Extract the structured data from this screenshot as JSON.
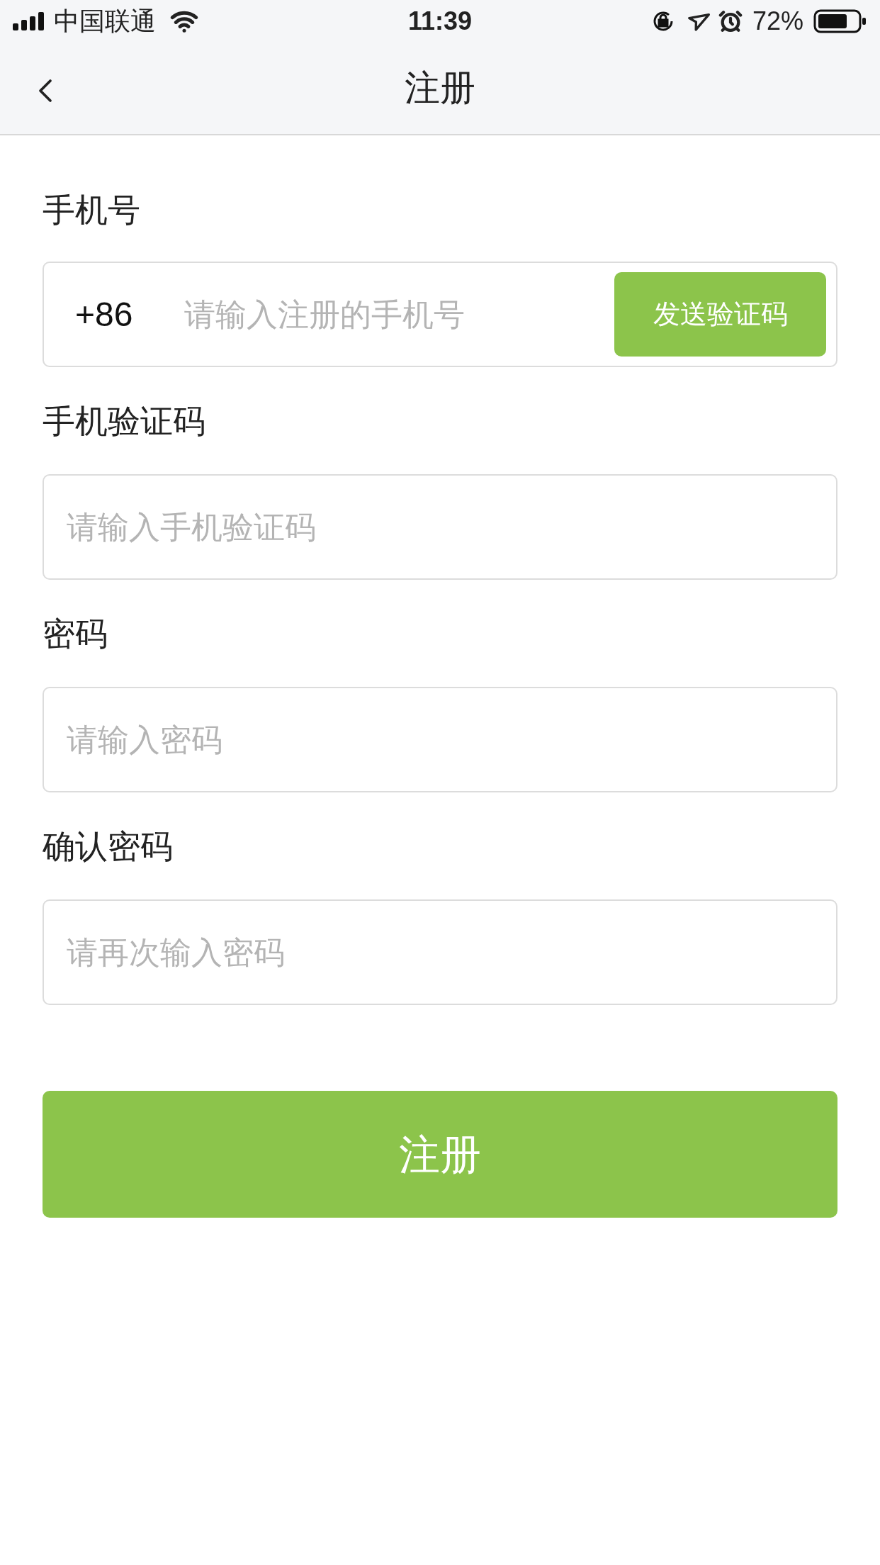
{
  "status_bar": {
    "carrier": "中国联通",
    "time": "11:39",
    "battery": "72%"
  },
  "nav": {
    "title": "注册"
  },
  "phone": {
    "label": "手机号",
    "prefix": "+86",
    "placeholder": "请输入注册的手机号",
    "send_button": "发送验证码"
  },
  "fields": [
    {
      "label": "手机验证码",
      "placeholder": "请输入手机验证码"
    },
    {
      "label": "密码",
      "placeholder": "请输入密码"
    },
    {
      "label": "确认密码",
      "placeholder": "请再次输入密码"
    }
  ],
  "submit": "注册"
}
